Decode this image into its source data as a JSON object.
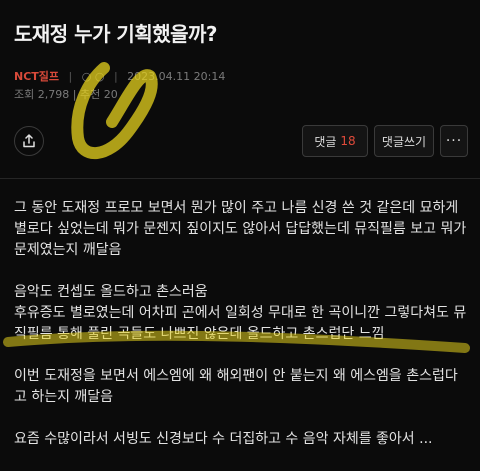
{
  "post": {
    "title": "도재정 누가 기획했을까?",
    "author": "NCT질프",
    "author_badges": "○ ○",
    "date": "2023.04.11 20:14",
    "views_label": "조회",
    "views": "2,798",
    "likes_label": "추천",
    "likes": "20"
  },
  "actions": {
    "comments_label": "댓글",
    "comments_count": "18",
    "write_comment_label": "댓글쓰기",
    "more_label": "···"
  },
  "content": {
    "paragraphs": [
      "그 동안 도재정 프로모 보면서 뭔가 많이 주고 나름 신경 쓴 것 같은데 묘하게 별로다 싶었는데 뭐가 문젠지 짚이지도 않아서 답답했는데 뮤직필름 보고 뭐가 문제였는지 깨달음",
      "음악도 컨셉도 올드하고 촌스러움\n후유증도 별로였는데 어차피 곤에서 일회성 무대로 한 곡이니깐 그렇다쳐도 뮤직필름 통해 풀린 곡들도 나쁘진 않은데 올드하고 촌스럽단 느낌",
      "이번 도재정을 보면서 에스엠에 왜 해외팬이 안 붙는지 왜 에스엠을 촌스럽다고 하는지 깨달음",
      "요즘 수많이라서 서빙도 신경보다 수 더집하고 수 음악 자체를 좋아서 ..."
    ]
  },
  "colors": {
    "background": "#0b0b0b",
    "author": "#d84a3a",
    "comment_count": "#e04a3a",
    "highlighter": "#e6d21e"
  },
  "icons": {
    "share": "share-icon",
    "more": "more-dots-icon"
  }
}
